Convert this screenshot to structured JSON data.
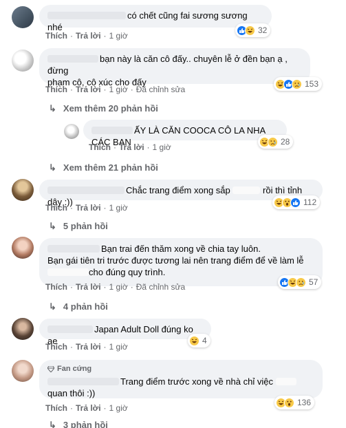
{
  "comments": [
    {
      "text": "có chết cũng fai sương sương nhé",
      "actions": {
        "like": "Thích",
        "reply": "Trả lời",
        "time": "1 giờ"
      },
      "reactions": {
        "icons": [
          "like-icon",
          "haha-icon"
        ],
        "count": "32"
      }
    },
    {
      "text_line1": "bạn này là căn cô đấy.. chuyên lễ ở đền bạn ạ , đừng",
      "text_line2": "phạm cô, cô xúc cho đấy",
      "actions": {
        "like": "Thích",
        "reply": "Trả lời",
        "time": "1 giờ",
        "edited": "Đã chỉnh sửa"
      },
      "reactions": {
        "icons": [
          "haha-icon",
          "like-icon",
          "sad-icon"
        ],
        "count": "153"
      },
      "more_replies": "Xem thêm 20 phản hồi"
    },
    {
      "text": "ẤY LÀ CĂN COOCA CÔ LA NHA CÁC BẠN",
      "actions": {
        "like": "Thích",
        "reply": "Trả lời",
        "time": "1 giờ"
      },
      "reactions": {
        "icons": [
          "haha-icon",
          "sad-icon"
        ],
        "count": "28"
      },
      "more_replies": "Xem thêm 21 phản hồi"
    },
    {
      "text_a": "Chắc trang điểm xong sắp",
      "text_b": "rồi thì tỉnh dậy :))",
      "actions": {
        "like": "Thích",
        "reply": "Trả lời",
        "time": "1 giờ"
      },
      "reactions": {
        "icons": [
          "haha-icon",
          "wow-icon",
          "like-icon"
        ],
        "count": "112"
      },
      "more_replies": "5 phản hồi"
    },
    {
      "text_line1": "Bạn trai đến thăm xong về chia tay luôn.",
      "text_line2": "Bạn gái tiên tri trước được tương lai nên trang điểm để về làm lễ",
      "text_line3": "cho đúng quy trình.",
      "actions": {
        "like": "Thích",
        "reply": "Trả lời",
        "time": "1 giờ",
        "edited": "Đã chỉnh sửa"
      },
      "reactions": {
        "icons": [
          "like-icon",
          "haha-icon",
          "sad-icon"
        ],
        "count": "57"
      },
      "more_replies": "4 phản hồi"
    },
    {
      "text": "Japan Adult Doll đúng ko ae",
      "actions": {
        "like": "Thích",
        "reply": "Trả lời",
        "time": "1 giờ"
      },
      "reactions": {
        "icons": [
          "haha-icon"
        ],
        "count": "4"
      }
    },
    {
      "badge": "Fan cứng",
      "text_line1": "Trang điểm trước xong về nhà chỉ việc",
      "text_line2": "quan thôi :))",
      "actions": {
        "like": "Thích",
        "reply": "Trả lời",
        "time": "1 giờ"
      },
      "reactions": {
        "icons": [
          "haha-icon",
          "wow-icon"
        ],
        "count": "136"
      },
      "more_replies": "3 phản hồi"
    }
  ],
  "colors": {
    "bubble": "#f0f2f5",
    "meta": "#65676b",
    "like": "#1877f2",
    "emoji": "#f7c948"
  }
}
